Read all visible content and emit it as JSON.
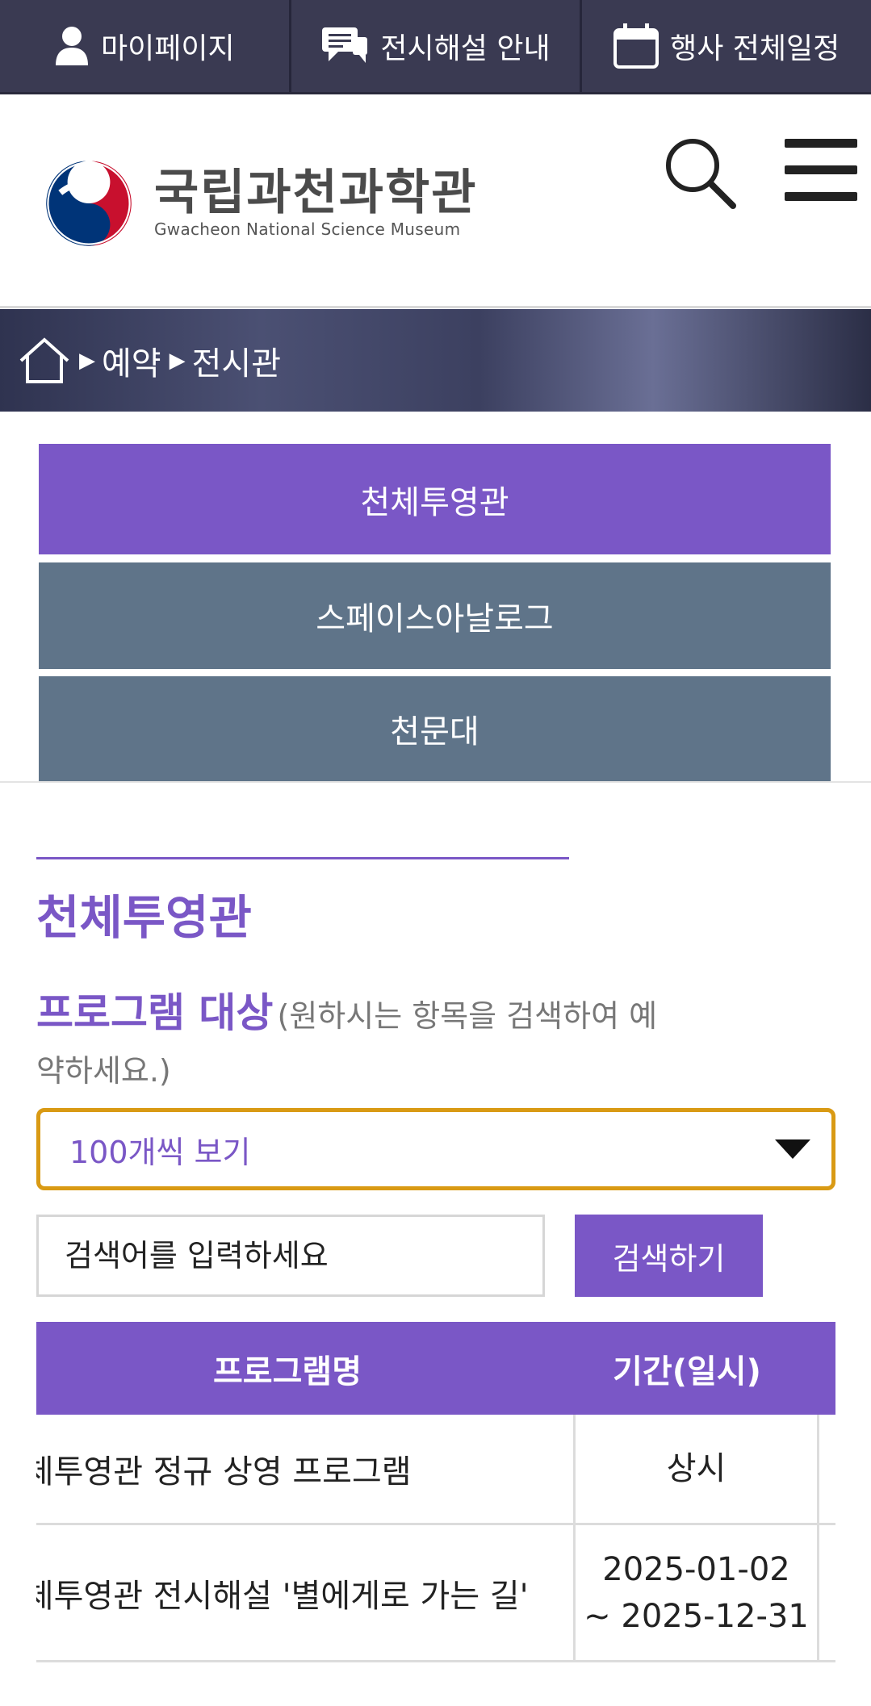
{
  "topbar": {
    "items": [
      {
        "label": "마이페이지",
        "icon": "user-icon"
      },
      {
        "label": "전시해설 안내",
        "icon": "chat-icon"
      },
      {
        "label": "행사 전체일정",
        "icon": "calendar-icon"
      }
    ]
  },
  "header": {
    "logo_ko": "국립과천과학관",
    "logo_en": "Gwacheon National Science Museum",
    "search_icon": "search-icon",
    "menu_icon": "hamburger-menu-icon"
  },
  "breadcrumb": {
    "home_icon": "home-icon",
    "items": [
      "예약",
      "전시관"
    ]
  },
  "tabs": [
    {
      "label": "천체투영관",
      "active": true
    },
    {
      "label": "스페이스아날로그",
      "active": false
    },
    {
      "label": "천문대",
      "active": false
    }
  ],
  "section": {
    "title": "천체투영관",
    "program_label": "프로그램 대상",
    "program_hint": "(원하시는 항목을 검색하여 예약하세요.)"
  },
  "filter": {
    "selected": "100개씩 보기"
  },
  "search": {
    "placeholder": "검색어를 입력하세요",
    "button_label": "검색하기"
  },
  "table": {
    "headers": [
      "프로그램명",
      "기간(일시)"
    ],
    "rows": [
      {
        "name": "천체투영관 정규 상영 프로그램",
        "period": "상시"
      },
      {
        "name": "천체투영관 전시해설 '별에게로 가는 길'",
        "period_start": "2025-01-02",
        "period_end": "~ 2025-12-31"
      }
    ]
  },
  "colors": {
    "accent": "#7a57c6",
    "tab_inactive": "#5f7489",
    "topbar": "#3a3a52",
    "select_border": "#d99a14"
  }
}
